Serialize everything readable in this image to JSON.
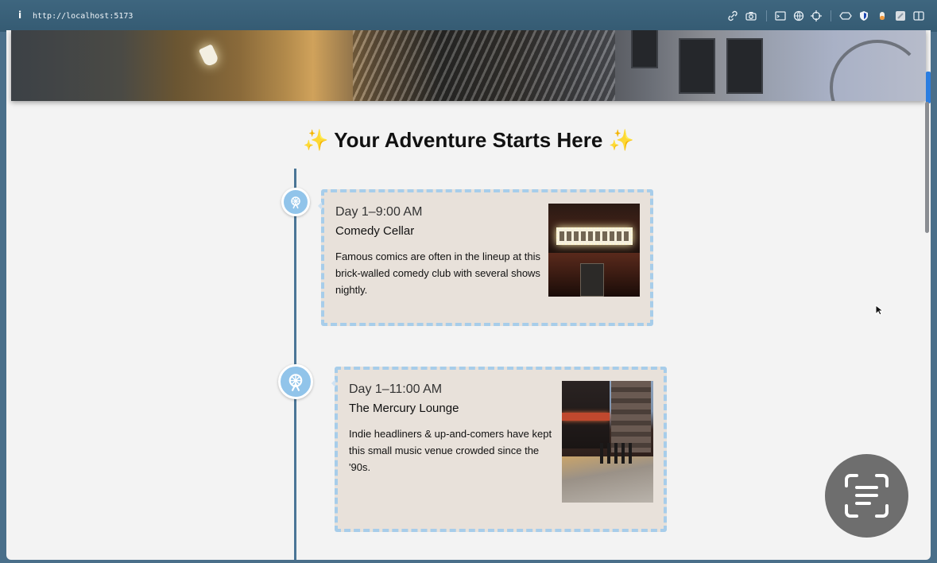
{
  "browser": {
    "url": "http://localhost:5173",
    "toolbar_icons": [
      "link-icon",
      "camera-icon",
      "terminal-icon",
      "globe-icon",
      "crosshair-icon",
      "extension-icon",
      "shield-icon",
      "fox-icon",
      "puzzle-icon",
      "sidebar-icon"
    ]
  },
  "page": {
    "title": "Your Adventure Starts Here",
    "title_emoji_left": "✨",
    "title_emoji_right": "✨"
  },
  "timeline": {
    "line_color": "#4a7596",
    "node_color": "#91c4ea",
    "items": [
      {
        "time": "Day 1–9:00 AM",
        "name": "Comedy Cellar",
        "description": "Famous comics are often in the lineup at this brick-walled comedy club with several shows nightly.",
        "photo_icon": "comedy-cellar-photo"
      },
      {
        "time": "Day 1–11:00 AM",
        "name": "The Mercury Lounge",
        "description": "Indie headliners & up-and-comers have kept this small music venue crowded since the '90s.",
        "photo_icon": "mercury-lounge-photo"
      }
    ]
  },
  "colors": {
    "card_bg": "#e8e1da",
    "card_border": "#a7cdea",
    "page_bg": "#f3f3f3"
  },
  "ocr_button": {
    "icon": "text-scan-icon"
  }
}
